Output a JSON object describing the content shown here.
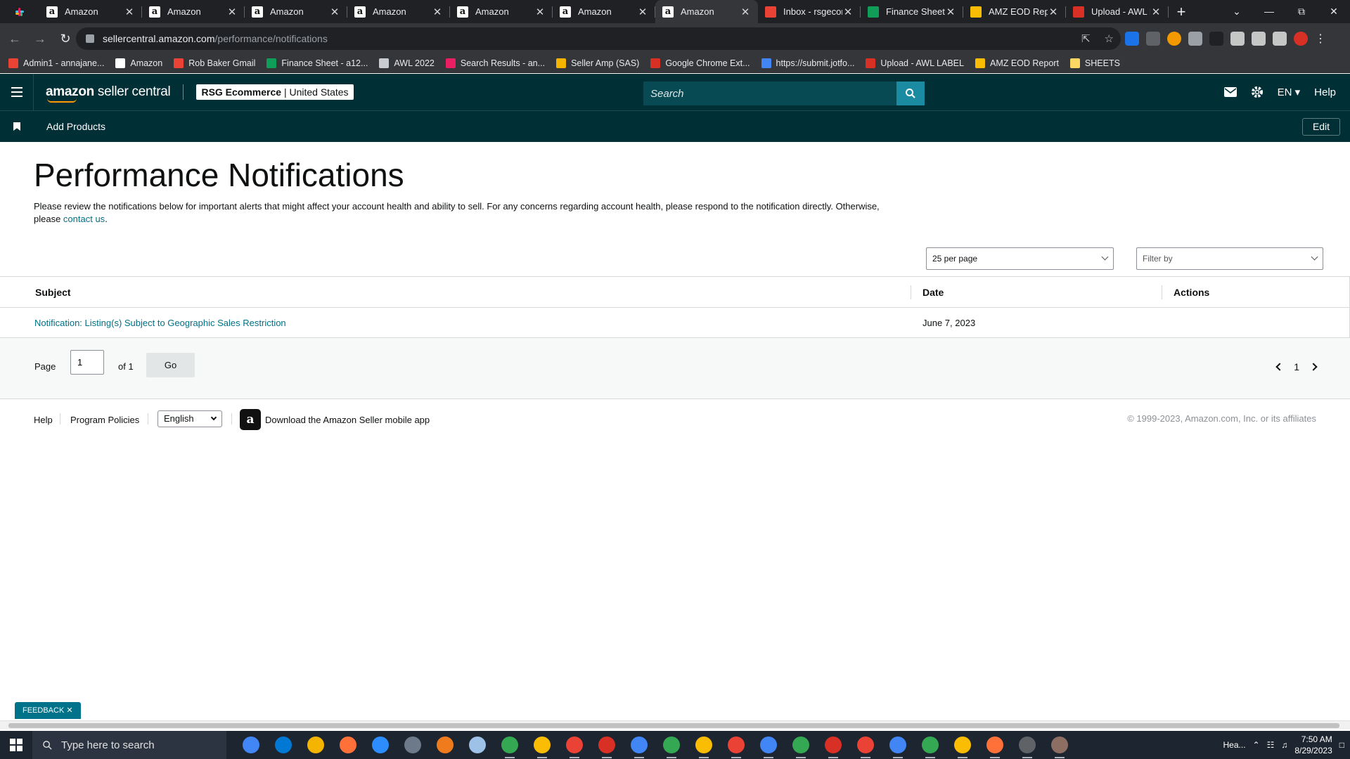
{
  "browser": {
    "tabs": [
      {
        "title": "Amazon",
        "favicon": "amazon"
      },
      {
        "title": "Amazon",
        "favicon": "amazon"
      },
      {
        "title": "Amazon",
        "favicon": "amazon"
      },
      {
        "title": "Amazon",
        "favicon": "amazon"
      },
      {
        "title": "Amazon",
        "favicon": "amazon"
      },
      {
        "title": "Amazon",
        "favicon": "amazon"
      },
      {
        "title": "Amazon",
        "favicon": "amazon",
        "active": true
      },
      {
        "title": "Inbox - rsgecom",
        "favicon": "gmail"
      },
      {
        "title": "Finance Sheet - ",
        "favicon": "sheets"
      },
      {
        "title": "AMZ EOD Repo",
        "favicon": "pencil"
      },
      {
        "title": "Upload - AWL L",
        "favicon": "awl"
      }
    ],
    "url_host": "sellercentral.amazon.com",
    "url_path": "/performance/notifications",
    "bookmarks": [
      {
        "label": "Admin1 - annajane...",
        "color": "#ea4335"
      },
      {
        "label": "Amazon",
        "color": "#ffffff"
      },
      {
        "label": "Rob Baker Gmail",
        "color": "#ea4335"
      },
      {
        "label": "Finance Sheet - a12...",
        "color": "#0f9d58"
      },
      {
        "label": "AWL 2022",
        "color": "#c9ccd1"
      },
      {
        "label": "Search Results - an...",
        "color": "#e91e63"
      },
      {
        "label": "Seller Amp (SAS)",
        "color": "#f4b400"
      },
      {
        "label": "Google Chrome Ext...",
        "color": "#d93025"
      },
      {
        "label": "https://submit.jotfo...",
        "color": "#4285f4"
      },
      {
        "label": "Upload - AWL LABEL",
        "color": "#d93025"
      },
      {
        "label": "AMZ EOD Report",
        "color": "#fbbc04"
      },
      {
        "label": "SHEETS",
        "color": "#fdd663"
      }
    ]
  },
  "header": {
    "logo_bold": "amazon",
    "logo_rest": " seller central",
    "store_name": "RSG Ecommerce",
    "store_region": "United States",
    "search_placeholder": "Search",
    "language": "EN",
    "help": "Help"
  },
  "subnav": {
    "add_products": "Add Products",
    "edit": "Edit"
  },
  "page": {
    "title": "Performance Notifications",
    "intro": "Please review the notifications below for important alerts that might affect your account health and ability to sell. For any concerns regarding account health, please respond to the notification directly. Otherwise, please ",
    "contact_link": "contact us",
    "intro_end": ".",
    "per_page": "25 per page",
    "filter_placeholder": "Filter by"
  },
  "table": {
    "columns": [
      "Subject",
      "Date",
      "Actions"
    ],
    "rows": [
      {
        "subject": "Notification: Listing(s) Subject to Geographic Sales Restriction",
        "date": "June 7, 2023",
        "actions": ""
      }
    ]
  },
  "pagination": {
    "page_label": "Page",
    "page_value": "1",
    "of_label": "of 1",
    "go": "Go",
    "current_page": "1"
  },
  "footer": {
    "help": "Help",
    "policies": "Program Policies",
    "language": "English",
    "app_download": "Download the Amazon Seller mobile app",
    "copyright": "© 1999-2023, Amazon.com, Inc. or its affiliates"
  },
  "feedback": "FEEDBACK",
  "taskbar": {
    "search_placeholder": "Type here to search",
    "weather": "Hea...",
    "time": "7:50 AM",
    "date": "8/29/2023"
  }
}
